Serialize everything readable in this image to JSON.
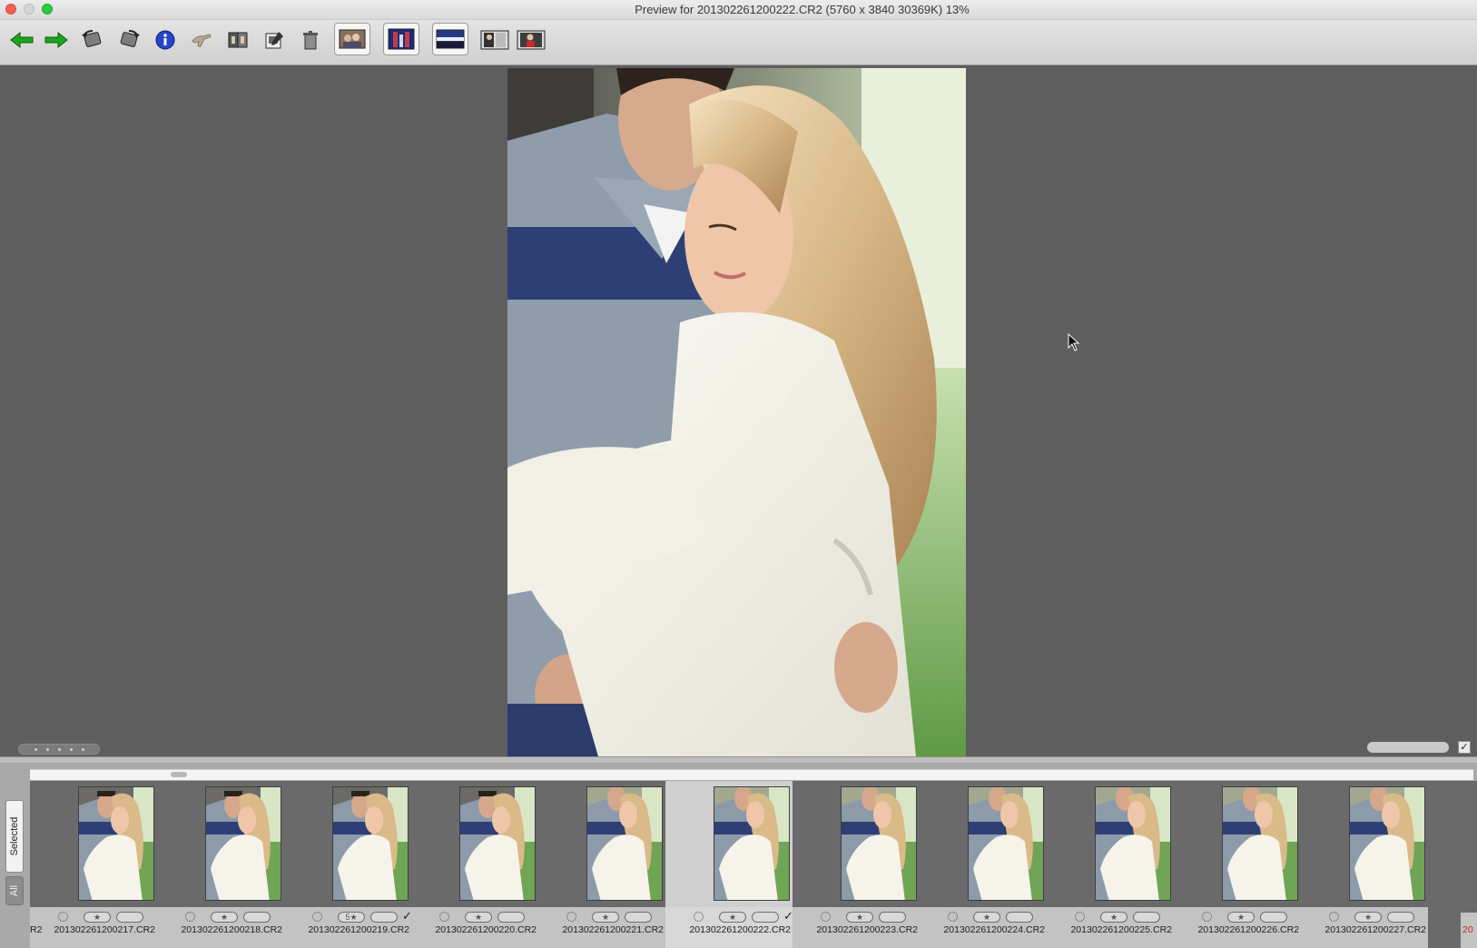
{
  "window": {
    "title": "Preview for 201302261200222.CR2 (5760 x 3840 30369K) 13%"
  },
  "toolbar": {
    "buttons": [
      {
        "name": "back-arrow-icon"
      },
      {
        "name": "forward-arrow-icon"
      },
      {
        "name": "rotate-left-icon"
      },
      {
        "name": "rotate-right-icon"
      },
      {
        "name": "info-icon"
      },
      {
        "name": "hand-tool-icon"
      },
      {
        "name": "compare-icon"
      },
      {
        "name": "edit-icon"
      },
      {
        "name": "trash-icon"
      },
      {
        "name": "view-fit-icon"
      },
      {
        "name": "view-portrait-icon"
      },
      {
        "name": "view-landscape-icon"
      },
      {
        "name": "view-single-icon"
      },
      {
        "name": "view-alt-icon"
      }
    ]
  },
  "filmstrip": {
    "tabs": {
      "selected": "Selected",
      "all": "All"
    },
    "left_edge_text": "R2",
    "right_edge_text": "20",
    "items": [
      {
        "filename": "201302261200217.CR2",
        "rating": "",
        "checked": false,
        "selected": false
      },
      {
        "filename": "201302261200218.CR2",
        "rating": "",
        "checked": false,
        "selected": false
      },
      {
        "filename": "201302261200219.CR2",
        "rating": "5★",
        "checked": true,
        "selected": false
      },
      {
        "filename": "201302261200220.CR2",
        "rating": "",
        "checked": false,
        "selected": false
      },
      {
        "filename": "201302261200221.CR2",
        "rating": "",
        "checked": false,
        "selected": false
      },
      {
        "filename": "201302261200222.CR2",
        "rating": "",
        "checked": true,
        "selected": true
      },
      {
        "filename": "201302261200223.CR2",
        "rating": "",
        "checked": false,
        "selected": false
      },
      {
        "filename": "201302261200224.CR2",
        "rating": "",
        "checked": false,
        "selected": false
      },
      {
        "filename": "201302261200225.CR2",
        "rating": "",
        "checked": false,
        "selected": false
      },
      {
        "filename": "201302261200226.CR2",
        "rating": "",
        "checked": false,
        "selected": false
      },
      {
        "filename": "201302261200227.CR2",
        "rating": "",
        "checked": false,
        "selected": false
      }
    ]
  },
  "viewer": {
    "apply_checkbox": "✓"
  }
}
